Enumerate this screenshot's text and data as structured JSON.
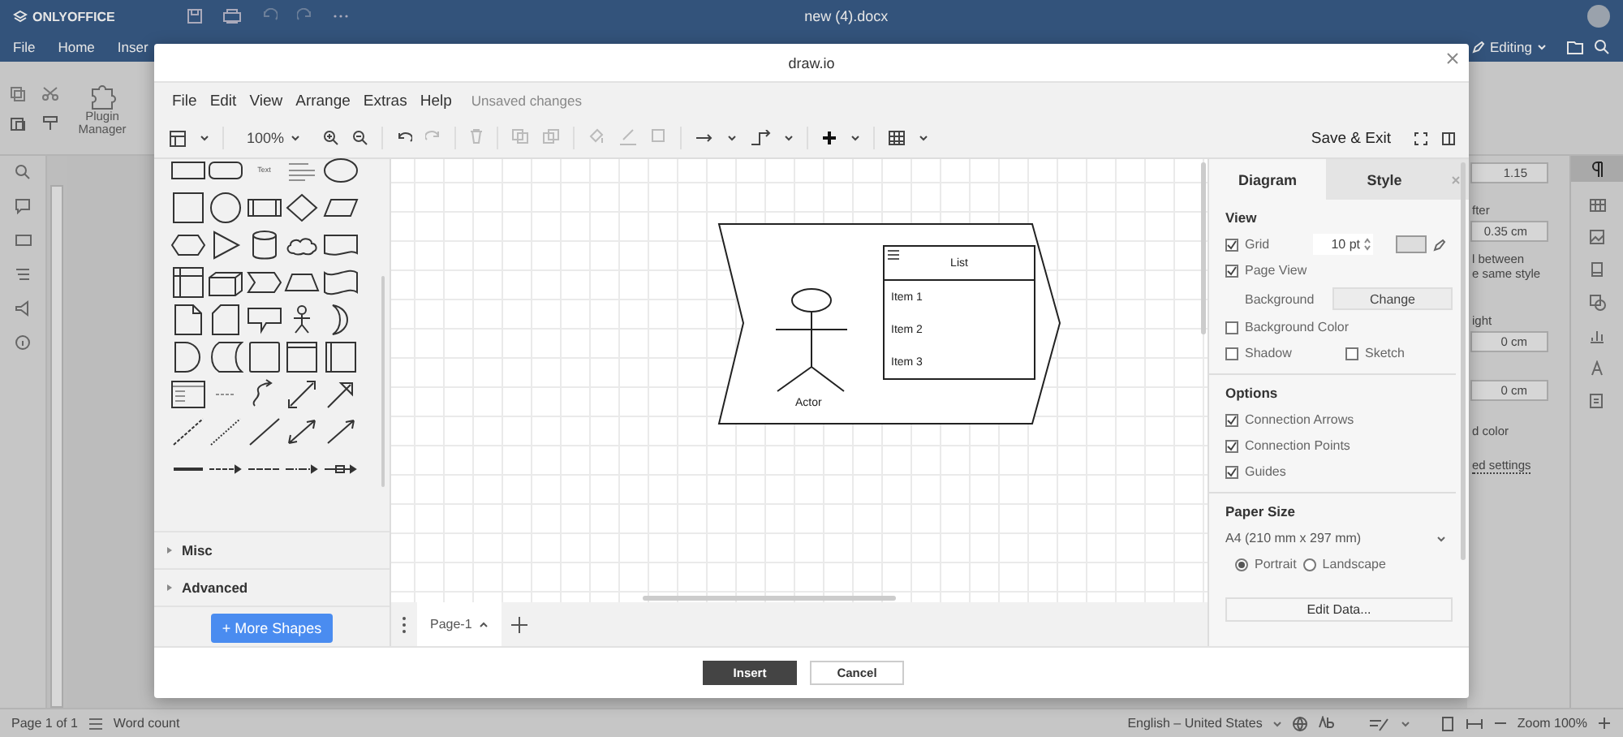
{
  "app": {
    "logo": "ONLYOFFICE",
    "document_title": "new (4).docx",
    "menu_tabs": [
      {
        "label": "File",
        "selected": false
      },
      {
        "label": "Home",
        "selected": false
      },
      {
        "label": "Inser",
        "selected": false
      }
    ],
    "plugin_button": "Plugin Manager",
    "mode": "Editing",
    "settings_panel": {
      "line_spacing": "1.15",
      "after_label": "fter",
      "after_value": "0.35 cm",
      "option_line_1": "l between",
      "option_line_2": "e same style",
      "right_label": "ight",
      "right_value": "0 cm",
      "first_value": "0 cm",
      "color_label": "d color",
      "settings_link": "ed settings"
    },
    "status_bar": {
      "page": "Page 1 of 1",
      "word_count": "Word count",
      "language": "English – United States",
      "zoom": "Zoom 100%"
    }
  },
  "dialog": {
    "title": "draw.io",
    "menu": [
      "File",
      "Edit",
      "View",
      "Arrange",
      "Extras",
      "Help"
    ],
    "status": "Unsaved changes",
    "zoom": "100%",
    "save_button": "Save & Exit",
    "palette": {
      "text_shape": "Text",
      "sections": [
        {
          "label": "Misc",
          "expanded": false
        },
        {
          "label": "Advanced",
          "expanded": false
        }
      ],
      "more_button": "+ More Shapes"
    },
    "diagram": {
      "actor_label": "Actor",
      "list_title": "List",
      "list_items": [
        "Item 1",
        "Item 2",
        "Item 3"
      ]
    },
    "page_tabs": [
      {
        "label": "Page-1",
        "selected": true
      }
    ],
    "format_panel": {
      "tabs": [
        {
          "label": "Diagram",
          "selected": true
        },
        {
          "label": "Style",
          "selected": false
        }
      ],
      "view_heading": "View",
      "grid": {
        "label": "Grid",
        "checked": true,
        "size": "10 pt"
      },
      "page_view": {
        "label": "Page View",
        "checked": true
      },
      "background_label": "Background",
      "change_button": "Change",
      "background_color": {
        "label": "Background Color",
        "checked": false
      },
      "shadow": {
        "label": "Shadow",
        "checked": false
      },
      "sketch": {
        "label": "Sketch",
        "checked": false
      },
      "options_heading": "Options",
      "options": [
        {
          "label": "Connection Arrows",
          "checked": true
        },
        {
          "label": "Connection Points",
          "checked": true
        },
        {
          "label": "Guides",
          "checked": true
        }
      ],
      "paper_heading": "Paper Size",
      "paper_size": "A4 (210 mm x 297 mm)",
      "orientation": [
        {
          "label": "Portrait",
          "selected": true
        },
        {
          "label": "Landscape",
          "selected": false
        }
      ],
      "edit_data_button": "Edit Data..."
    },
    "buttons": [
      {
        "label": "Insert",
        "kind": "primary"
      },
      {
        "label": "Cancel",
        "kind": "secondary"
      }
    ]
  }
}
